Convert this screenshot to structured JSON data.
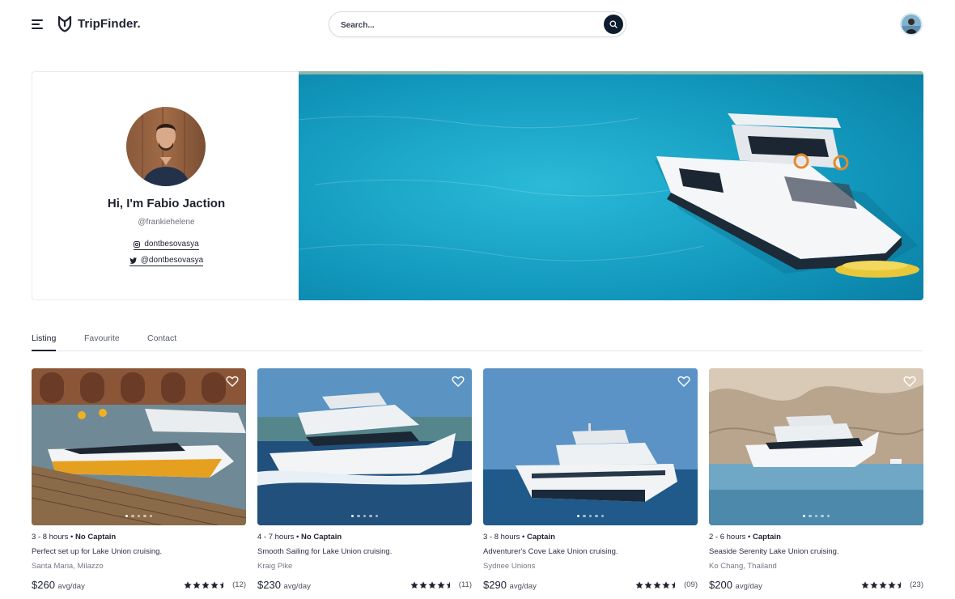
{
  "brand": {
    "name": "TripFinder.",
    "logo_icon": "shield-logo-icon"
  },
  "search": {
    "placeholder": "Search...",
    "icon": "search-icon"
  },
  "profile": {
    "name": "Hi, I'm Fabio Jaction",
    "handle": "@frankiehelene",
    "instagram": "dontbesovasya",
    "twitter": "@dontbesovasya"
  },
  "tabs": [
    {
      "label": "Listing",
      "active": true
    },
    {
      "label": "Favourite",
      "active": false
    },
    {
      "label": "Contact",
      "active": false
    }
  ],
  "listings": [
    {
      "duration": "3 - 8 hours",
      "captain": "No Captain",
      "title": "Perfect set up for Lake Union cruising.",
      "location": "Santa Maria, Milazzo",
      "price": "$260",
      "unit": "avg/day",
      "rating": 4.5,
      "reviews": "(12)"
    },
    {
      "duration": "4 - 7 hours",
      "captain": "No Captain",
      "title": "Smooth Sailing for Lake Union cruising.",
      "location": "Kraig Pike",
      "price": "$230",
      "unit": "avg/day",
      "rating": 4.5,
      "reviews": "(11)"
    },
    {
      "duration": "3 - 8 hours",
      "captain": "Captain",
      "title": "Adventurer's Cove Lake Union cruising.",
      "location": "Sydnee Unions",
      "price": "$290",
      "unit": "avg/day",
      "rating": 4.5,
      "reviews": "(09)"
    },
    {
      "duration": "2 - 6 hours",
      "captain": "Captain",
      "title": "Seaside Serenity Lake Union cruising.",
      "location": "Ko Chang, Thailand",
      "price": "$200",
      "unit": "avg/day",
      "rating": 4.5,
      "reviews": "(23)"
    }
  ],
  "colors": {
    "dark": "#0f1c2e",
    "sea": "#1aa6c8",
    "text": "#1f2230"
  }
}
